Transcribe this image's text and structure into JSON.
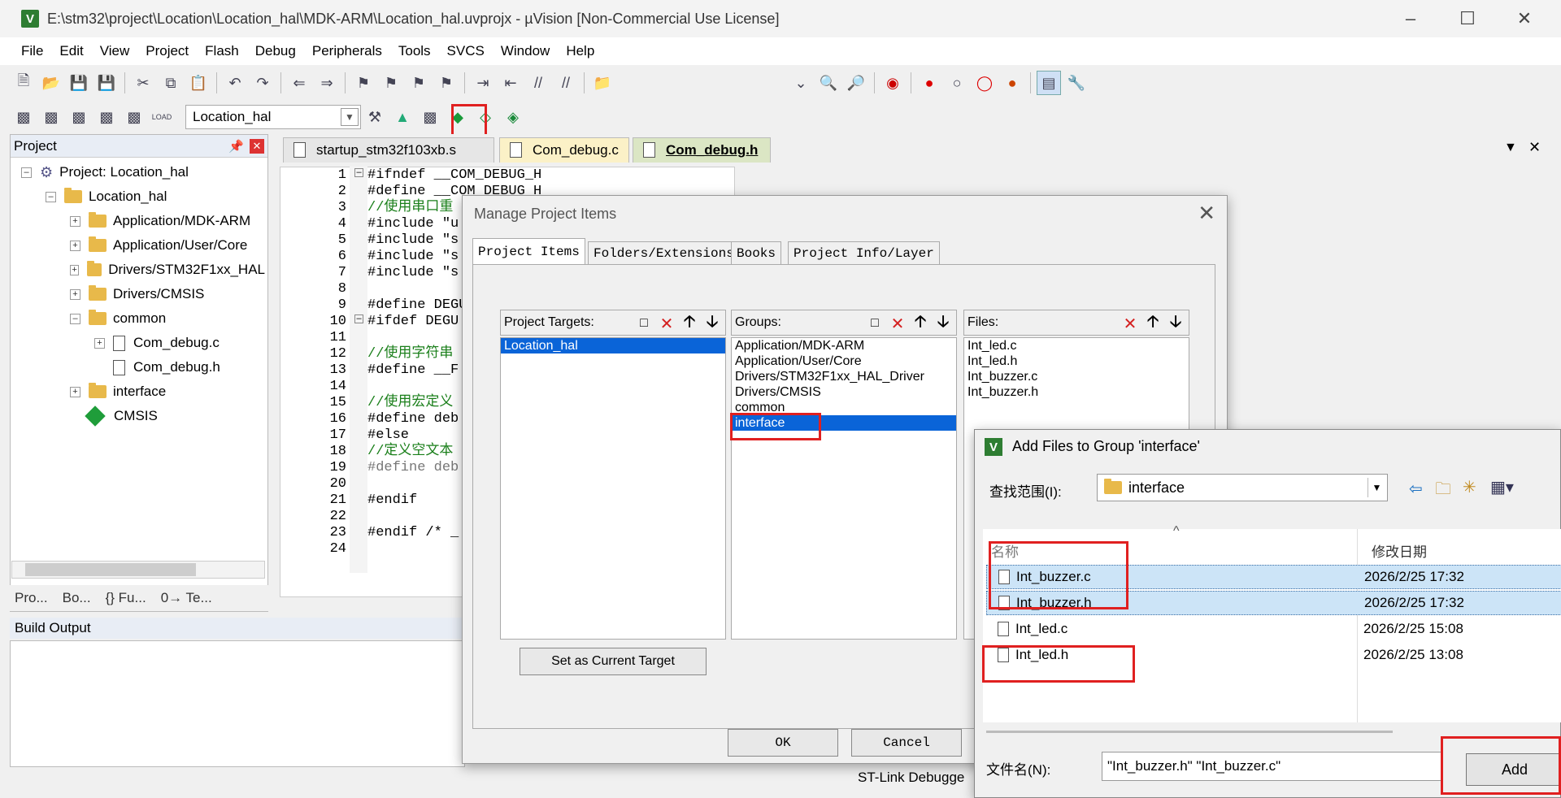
{
  "window": {
    "title": "E:\\stm32\\project\\Location\\Location_hal\\MDK-ARM\\Location_hal.uvprojx - µVision  [Non-Commercial Use License]",
    "app_icon": "V"
  },
  "menu": [
    "File",
    "Edit",
    "View",
    "Project",
    "Flash",
    "Debug",
    "Peripherals",
    "Tools",
    "SVCS",
    "Window",
    "Help"
  ],
  "toolbar2": {
    "load_label": "LOAD",
    "target_value": "Location_hal"
  },
  "project_panel": {
    "title": "Project",
    "tree": [
      {
        "label": "Project: Location_hal"
      },
      {
        "label": "Location_hal"
      },
      {
        "label": "Application/MDK-ARM"
      },
      {
        "label": "Application/User/Core"
      },
      {
        "label": "Drivers/STM32F1xx_HAL"
      },
      {
        "label": "Drivers/CMSIS"
      },
      {
        "label": "common"
      },
      {
        "label": "Com_debug.c"
      },
      {
        "label": "Com_debug.h"
      },
      {
        "label": "interface"
      },
      {
        "label": "CMSIS"
      }
    ],
    "bottom_tabs": [
      "Pro...",
      "Bo...",
      "{} Fu...",
      "0→ Te..."
    ]
  },
  "editor": {
    "tabs": [
      "startup_stm32f103xb.s",
      "Com_debug.c",
      "Com_debug.h"
    ],
    "line_numbers": [
      "1",
      "2",
      "3",
      "4",
      "5",
      "6",
      "7",
      "8",
      "9",
      "10",
      "11",
      "12",
      "13",
      "14",
      "15",
      "16",
      "17",
      "18",
      "19",
      "20",
      "21",
      "22",
      "23",
      "24"
    ],
    "lines": [
      "#ifndef __COM_DEBUG_H",
      "#define __COM_DEBUG_H",
      "//使用串口重",
      "#include \"u",
      "#include \"s",
      "#include \"s",
      "#include \"s",
      "",
      "#define DEGU",
      "#ifdef DEGU",
      "",
      "//使用字符串",
      "#define __F",
      "",
      "//使用宏定义",
      "#define deb",
      "#else",
      "//定义空文本",
      "#define deb",
      "",
      "#endif",
      "",
      "#endif /* _",
      ""
    ]
  },
  "build_output": {
    "title": "Build Output"
  },
  "status": {
    "debugger": "ST-Link Debugge"
  },
  "manage_dialog": {
    "title": "Manage Project Items",
    "tabs": [
      "Project Items",
      "Folders/Extensions",
      "Books",
      "Project Info/Layer"
    ],
    "targets_label": "Project Targets:",
    "targets": [
      "Location_hal"
    ],
    "groups_label": "Groups:",
    "groups": [
      "Application/MDK-ARM",
      "Application/User/Core",
      "Drivers/STM32F1xx_HAL_Driver",
      "Drivers/CMSIS",
      "common",
      "interface"
    ],
    "files_label": "Files:",
    "files": [
      "Int_led.c",
      "Int_led.h",
      "Int_buzzer.c",
      "Int_buzzer.h"
    ],
    "set_target_button": "Set as Current Target",
    "ok_button": "OK",
    "cancel_button": "Cancel"
  },
  "add_files_dialog": {
    "title": "Add Files to Group 'interface'",
    "look_in_label": "查找范围(I):",
    "look_in_value": "interface",
    "col_name": "名称",
    "col_date": "修改日期",
    "files": [
      {
        "name": "Int_buzzer.c",
        "date": "2026/2/25 17:32"
      },
      {
        "name": "Int_buzzer.h",
        "date": "2026/2/25 17:32"
      },
      {
        "name": "Int_led.c",
        "date": "2026/2/25 15:08"
      },
      {
        "name": "Int_led.h",
        "date": "2026/2/25 13:08"
      }
    ],
    "filename_label": "文件名(N):",
    "filename_value": "\"Int_buzzer.h\" \"Int_buzzer.c\"",
    "add_button": "Add"
  }
}
